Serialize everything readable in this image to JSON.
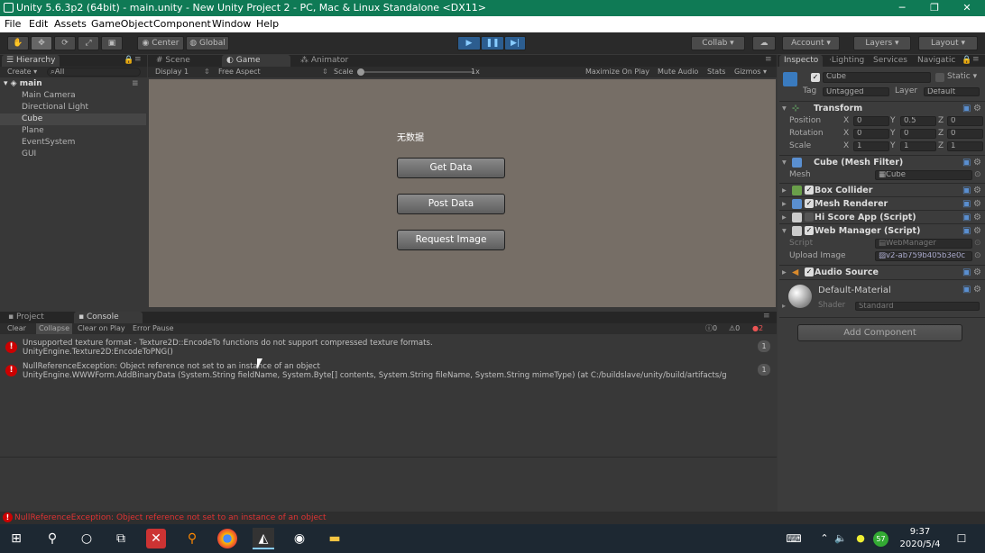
{
  "titlebar": {
    "title": "Unity 5.6.3p2 (64bit) - main.unity - New Unity Project 2 - PC, Mac & Linux Standalone <DX11>",
    "minimize": "─",
    "maximize": "❐",
    "close": "✕"
  },
  "menu": [
    "File",
    "Edit",
    "Assets",
    "GameObject",
    "Component",
    "Window",
    "Help"
  ],
  "toolbar": {
    "center": "Center",
    "global": "Global",
    "collab": "Collab ▾",
    "account": "Account ▾",
    "layers": "Layers ▾",
    "layout": "Layout ▾"
  },
  "hierarchy": {
    "tab": "Hierarchy",
    "create": "Create ▾",
    "search_placeholder": "All",
    "scene": "main",
    "items": [
      "Main Camera",
      "Directional Light",
      "Cube",
      "Plane",
      "EventSystem",
      "GUI"
    ],
    "selected": "Cube"
  },
  "center_tabs": {
    "scene": "Scene",
    "game": "Game",
    "animator": "Animator"
  },
  "game_toolbar": {
    "display": "Display 1",
    "aspect": "Free Aspect",
    "scale_label": "Scale",
    "scale_value": "1x",
    "maximize": "Maximize On Play",
    "mute": "Mute Audio",
    "stats": "Stats",
    "gizmos": "Gizmos ▾"
  },
  "game_view": {
    "status_text": "无数据",
    "buttons": [
      "Get Data",
      "Post Data",
      "Request Image"
    ]
  },
  "bottom_tabs": {
    "project": "Project",
    "console": "Console"
  },
  "console_toolbar": {
    "clear": "Clear",
    "collapse": "Collapse",
    "clear_on_play": "Clear on Play",
    "error_pause": "Error Pause",
    "log_count": "0",
    "warn_count": "0",
    "error_count": "2"
  },
  "console_entries": [
    {
      "line1": "Unsupported texture format - Texture2D::EncodeTo functions do not support compressed texture formats.",
      "line2": "UnityEngine.Texture2D:EncodeToPNG()",
      "count": "1"
    },
    {
      "line1": "NullReferenceException: Object reference not set to an instance of an object",
      "line2": "UnityEngine.WWWForm.AddBinaryData (System.String fieldName, System.Byte[] contents, System.String fileName, System.String mimeType) (at C:/buildslave/unity/build/artifacts/g",
      "count": "1"
    }
  ],
  "status_bar": {
    "message": "NullReferenceException: Object reference not set to an instance of an object"
  },
  "inspector": {
    "tabs": [
      "Inspecto",
      "Lighting",
      "Services",
      "Navigatic"
    ],
    "object_name": "Cube",
    "static_label": "Static ▾",
    "tag_label": "Tag",
    "tag_value": "Untagged",
    "layer_label": "Layer",
    "layer_value": "Default",
    "transform": {
      "title": "Transform",
      "position": {
        "label": "Position",
        "x": "0",
        "y": "0.5",
        "z": "0"
      },
      "rotation": {
        "label": "Rotation",
        "x": "0",
        "y": "0",
        "z": "0"
      },
      "scale": {
        "label": "Scale",
        "x": "1",
        "y": "1",
        "z": "1"
      }
    },
    "mesh_filter": {
      "title": "Cube (Mesh Filter)",
      "mesh_label": "Mesh",
      "mesh_value": "Cube"
    },
    "components": [
      "Box Collider",
      "Mesh Renderer",
      "Hi Score App (Script)"
    ],
    "web_manager": {
      "title": "Web Manager (Script)",
      "script_label": "Script",
      "script_value": "WebManager",
      "upload_label": "Upload Image",
      "upload_value": "v2-ab759b405b3e0c"
    },
    "audio_source": "Audio Source",
    "material": {
      "name": "Default-Material",
      "shader_label": "Shader",
      "shader_value": "Standard"
    },
    "add_component": "Add Component"
  },
  "taskbar": {
    "time": "9:37",
    "date": "2020/5/4",
    "badge": "57"
  },
  "colors": {
    "title_green": "#0f7a55",
    "game_bg": "#766e66",
    "error_red": "#cc0000",
    "play_blue": "#2c5d8f"
  }
}
